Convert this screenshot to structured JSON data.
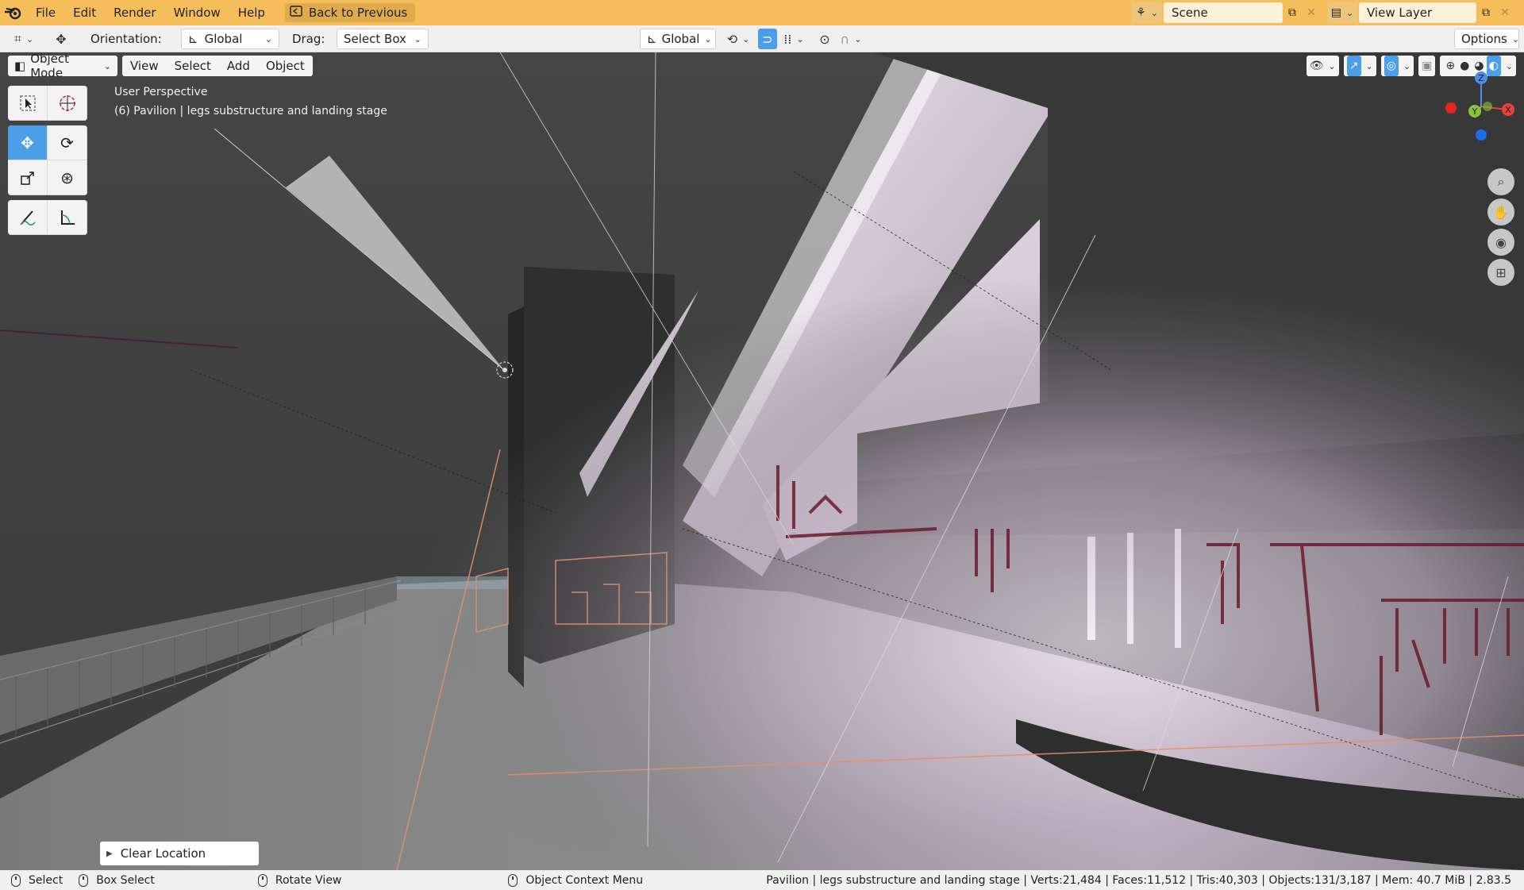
{
  "topbar": {
    "menu": [
      "File",
      "Edit",
      "Render",
      "Window",
      "Help"
    ],
    "back_label": "Back to Previous",
    "scene_label": "Scene",
    "view_layer_label": "View Layer"
  },
  "header": {
    "orientation_label": "Orientation:",
    "orientation_value": "Global",
    "drag_label": "Drag:",
    "drag_value": "Select Box",
    "transform_orientation": "Global",
    "options_label": "Options"
  },
  "viewport": {
    "mode": "Object Mode",
    "menus": [
      "View",
      "Select",
      "Add",
      "Object"
    ],
    "perspective_label": "User Perspective",
    "object_label": "(6) Pavilion | legs substructure and landing stage",
    "last_operator": "Clear Location",
    "gizmo": {
      "x": "X",
      "y": "Y",
      "z": "Z"
    }
  },
  "statusbar": {
    "select": "Select",
    "box_select": "Box Select",
    "rotate_view": "Rotate View",
    "context_menu": "Object Context Menu",
    "stats": "Pavilion | legs substructure and landing stage | Verts:21,484 | Faces:11,512 | Tris:40,303 | Objects:131/3,187 | Mem: 40.7 MiB | 2.83.5"
  },
  "colors": {
    "topbar": "#f5be5a",
    "accent_blue": "#4a9fe8",
    "axis_x": "#e8423f",
    "axis_y": "#8ac43f",
    "axis_z": "#4a8fe8"
  }
}
